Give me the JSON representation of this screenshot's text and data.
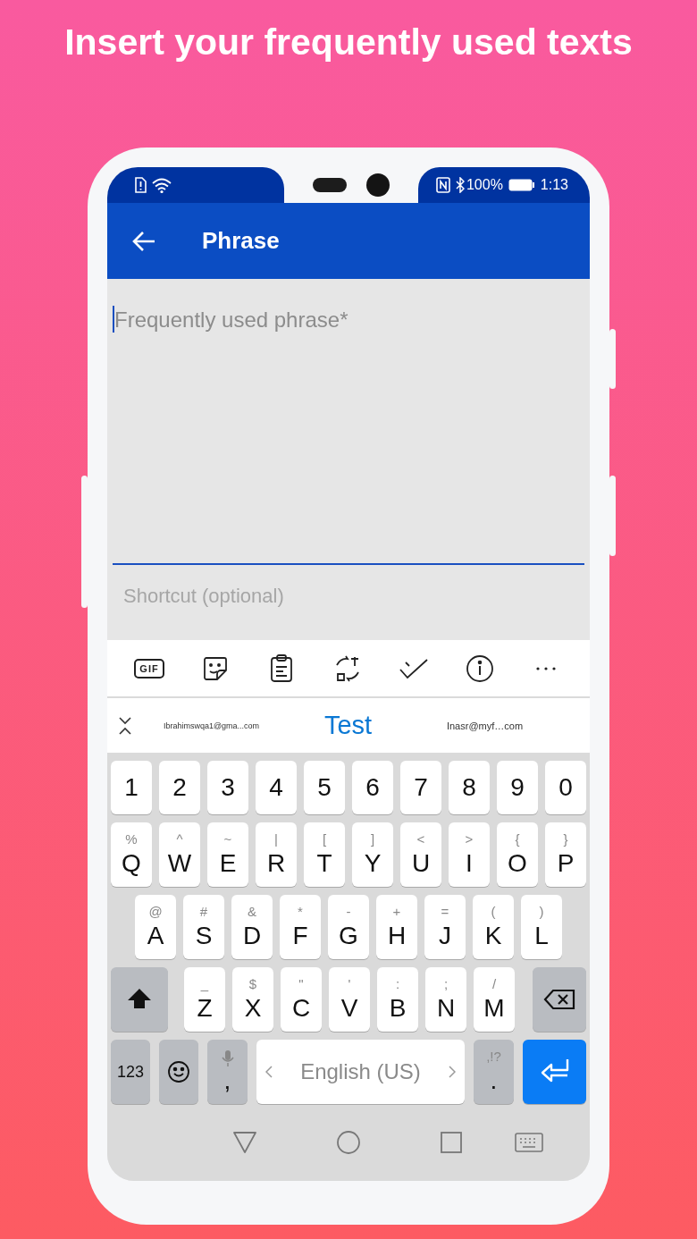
{
  "headline": "Insert your frequently used texts",
  "status_bar": {
    "battery": "100%",
    "time": "1:13"
  },
  "app_bar": {
    "title": "Phrase"
  },
  "phrase_field": {
    "placeholder": "Frequently used phrase*",
    "focused": true
  },
  "shortcut_field": {
    "placeholder": "Shortcut (optional)"
  },
  "keyboard": {
    "toolbar": [
      {
        "kind": "gif",
        "label": "GIF"
      },
      {
        "kind": "sticker"
      },
      {
        "kind": "clipboard"
      },
      {
        "kind": "translate"
      },
      {
        "kind": "check"
      },
      {
        "kind": "info"
      },
      {
        "kind": "more"
      }
    ],
    "suggestions": [
      {
        "text": "Ibrahimswqa1@gma...com",
        "selected": false
      },
      {
        "text": "Test",
        "selected": true
      },
      {
        "text": "Inasr@myf…com",
        "selected": false
      }
    ],
    "rows": [
      [
        {
          "kind": "char",
          "label": "1"
        },
        {
          "kind": "char",
          "label": "2"
        },
        {
          "kind": "char",
          "label": "3"
        },
        {
          "kind": "char",
          "label": "4"
        },
        {
          "kind": "char",
          "label": "5"
        },
        {
          "kind": "char",
          "label": "6"
        },
        {
          "kind": "char",
          "label": "7"
        },
        {
          "kind": "char",
          "label": "8"
        },
        {
          "kind": "char",
          "label": "9"
        },
        {
          "kind": "char",
          "label": "0"
        }
      ],
      [
        {
          "kind": "char",
          "label": "Q",
          "hint": "%"
        },
        {
          "kind": "char",
          "label": "W",
          "hint": "^"
        },
        {
          "kind": "char",
          "label": "E",
          "hint": "~"
        },
        {
          "kind": "char",
          "label": "R",
          "hint": "|"
        },
        {
          "kind": "char",
          "label": "T",
          "hint": "["
        },
        {
          "kind": "char",
          "label": "Y",
          "hint": "]"
        },
        {
          "kind": "char",
          "label": "U",
          "hint": "<"
        },
        {
          "kind": "char",
          "label": "I",
          "hint": ">"
        },
        {
          "kind": "char",
          "label": "O",
          "hint": "{"
        },
        {
          "kind": "char",
          "label": "P",
          "hint": "}"
        }
      ],
      [
        {
          "kind": "char",
          "label": "A",
          "hint": "@"
        },
        {
          "kind": "char",
          "label": "S",
          "hint": "#"
        },
        {
          "kind": "char",
          "label": "D",
          "hint": "&"
        },
        {
          "kind": "char",
          "label": "F",
          "hint": "*"
        },
        {
          "kind": "char",
          "label": "G",
          "hint": "-"
        },
        {
          "kind": "char",
          "label": "H",
          "hint": "+"
        },
        {
          "kind": "char",
          "label": "J",
          "hint": "="
        },
        {
          "kind": "char",
          "label": "K",
          "hint": "("
        },
        {
          "kind": "char",
          "label": "L",
          "hint": ")"
        }
      ],
      [
        {
          "kind": "shift"
        },
        {
          "kind": "char",
          "label": "Z",
          "hint": "_"
        },
        {
          "kind": "char",
          "label": "X",
          "hint": "$"
        },
        {
          "kind": "char",
          "label": "C",
          "hint": "\""
        },
        {
          "kind": "char",
          "label": "V",
          "hint": "'"
        },
        {
          "kind": "char",
          "label": "B",
          "hint": ":"
        },
        {
          "kind": "char",
          "label": "N",
          "hint": ";"
        },
        {
          "kind": "char",
          "label": "M",
          "hint": "/"
        },
        {
          "kind": "backspace"
        }
      ],
      [
        {
          "kind": "symbols",
          "label": "123"
        },
        {
          "kind": "emoji"
        },
        {
          "kind": "comma",
          "label": ","
        },
        {
          "kind": "space",
          "label": "English (US)"
        },
        {
          "kind": "period",
          "label": ".",
          "hint": ",!?"
        },
        {
          "kind": "enter"
        }
      ]
    ]
  }
}
